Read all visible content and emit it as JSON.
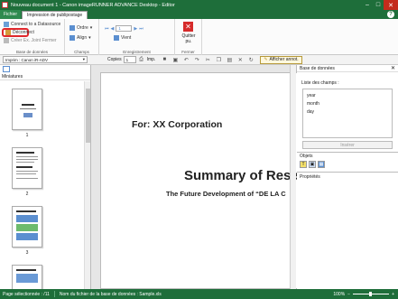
{
  "window": {
    "title": "Nouveau document 1 - Canon imageRUNNER ADVANCE Desktop - Editor",
    "minimize": "–",
    "maximize": "□",
    "close": "✕"
  },
  "tabs": {
    "file": "Fichier",
    "active": "Impression de publipostage",
    "help": "?"
  },
  "ribbon": {
    "group_db": {
      "label": "Base de données",
      "line1": "Connect to a Datasource",
      "disconnect": "Déconnect",
      "line3": "Créer Ex. Joint Fermer"
    },
    "group_fields": {
      "label": "Champs",
      "order": "Ordre",
      "align": "Align"
    },
    "group_record": {
      "label": "Enregistrement",
      "record_value": "1",
      "view": "Vient"
    },
    "group_close": {
      "label": "Fermer",
      "close_line1": "Quitter",
      "close_line2": "pu."
    }
  },
  "toolbar": {
    "printer": "Imprim : Canon iR-ADV",
    "copies_label": "Copies",
    "copies_value": "1",
    "print_label": "Imp.",
    "annotations": "Afficher annot."
  },
  "left_panel": {
    "title": "Miniatures",
    "pages": [
      "1",
      "2",
      "3"
    ]
  },
  "page": {
    "line1": "For: XX Corporation",
    "line2": "Summary of Rese",
    "line3": "The Future Development of “DE LA C"
  },
  "right_panel": {
    "title": "Base de données",
    "list_label": "Liste des champs :",
    "fields": [
      "year",
      "month",
      "day"
    ],
    "insert": "Insérer",
    "objects": "Objets",
    "properties": "Propriétés"
  },
  "status": {
    "page_selected": "Page sélectionnée : /11",
    "db_file": "Nom du fichier de la base de données : Sample.xls",
    "zoom": "100%"
  },
  "colors": {
    "accent": "#1e6e3a",
    "highlight": "#e0282d"
  }
}
